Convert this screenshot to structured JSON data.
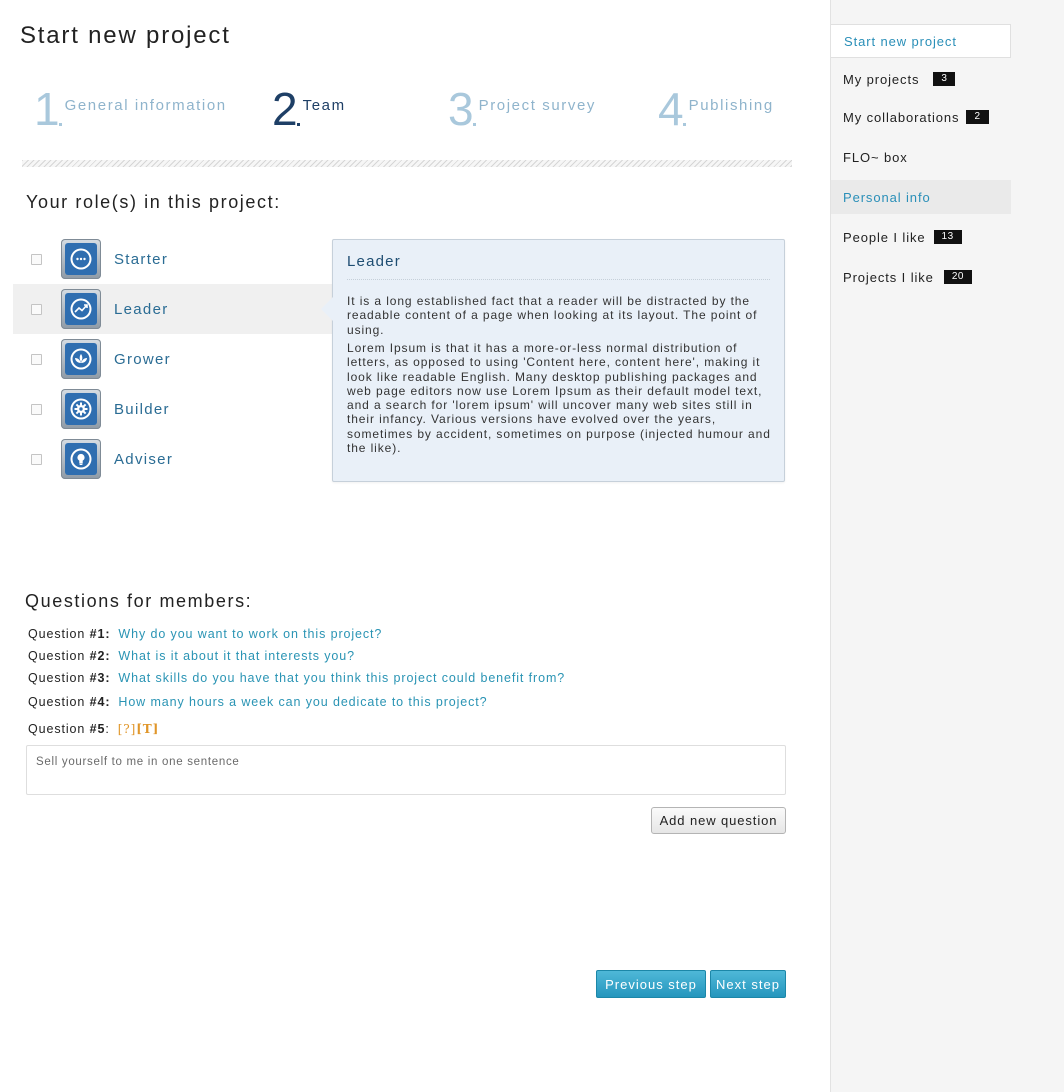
{
  "page": {
    "title": "Start new project"
  },
  "steps": [
    {
      "number": "1",
      "label": "General information"
    },
    {
      "number": "2",
      "label": "Team"
    },
    {
      "number": "3",
      "label": "Project survey"
    },
    {
      "number": "4",
      "label": "Publishing"
    }
  ],
  "roles_section": {
    "title": "Your role(s) in this project:",
    "roles": [
      {
        "label": "Starter",
        "icon": "chat-bubble-icon",
        "checked": false
      },
      {
        "label": "Leader",
        "icon": "trend-chart-icon",
        "checked": false
      },
      {
        "label": "Grower",
        "icon": "leaf-icon",
        "checked": false
      },
      {
        "label": "Builder",
        "icon": "gear-icon",
        "checked": false
      },
      {
        "label": "Adviser",
        "icon": "lightbulb-icon",
        "checked": false
      }
    ]
  },
  "popover": {
    "title": "Leader",
    "paragraph1": "It is a long established fact that a reader will be distracted by the readable content of a page when looking at its layout. The point of using.",
    "paragraph2": "Lorem Ipsum is that it has a more-or-less normal distribution of letters, as opposed to using 'Content here, content here', making it look like readable English. Many desktop publishing packages and web page editors now use Lorem Ipsum as their default model text, and a search for 'lorem ipsum' will uncover many web sites still in their infancy. Various versions have evolved over the years, sometimes by accident, sometimes on purpose (injected humour and the like)."
  },
  "questions_section": {
    "title": "Questions for members:",
    "questions": [
      {
        "prefix": "Question ",
        "number": "#1:",
        "text": "Why do you want to work on this project?"
      },
      {
        "prefix": "Question ",
        "number": "#2:",
        "text": "What is it about it that interests you?"
      },
      {
        "prefix": "Question ",
        "number": "#3:",
        "text": "What skills do you have that you think this project could benefit from?"
      },
      {
        "prefix": "Question ",
        "number": "#4:",
        "text": "How many hours a week can you dedicate to this project?"
      }
    ],
    "new_question": {
      "prefix": "Question ",
      "number": "#5",
      "suffix": ":",
      "tag_help": "[?]",
      "tag_text": "[T]",
      "placeholder": "Sell yourself to me in one sentence"
    },
    "add_button": "Add new question"
  },
  "footer": {
    "prev_button": "Previous step",
    "next_button": "Next step"
  },
  "sidebar": {
    "items": [
      {
        "label": "Start new project",
        "badge": ""
      },
      {
        "label": "My projects",
        "badge": "3"
      },
      {
        "label": "My collaborations",
        "badge": "2"
      },
      {
        "label": "FLO~ box",
        "badge": ""
      },
      {
        "label": "Personal info",
        "badge": ""
      },
      {
        "label": "People I like",
        "badge": "13"
      },
      {
        "label": "Projects I like",
        "badge": "20"
      }
    ]
  },
  "colors": {
    "accent": "#2a94b4",
    "step_active": "#1e3f66",
    "step_inactive": "#a9c8dc",
    "badge_bg": "#111111",
    "popover_bg": "#e9f0f8",
    "tag_orange": "#e0962a"
  }
}
